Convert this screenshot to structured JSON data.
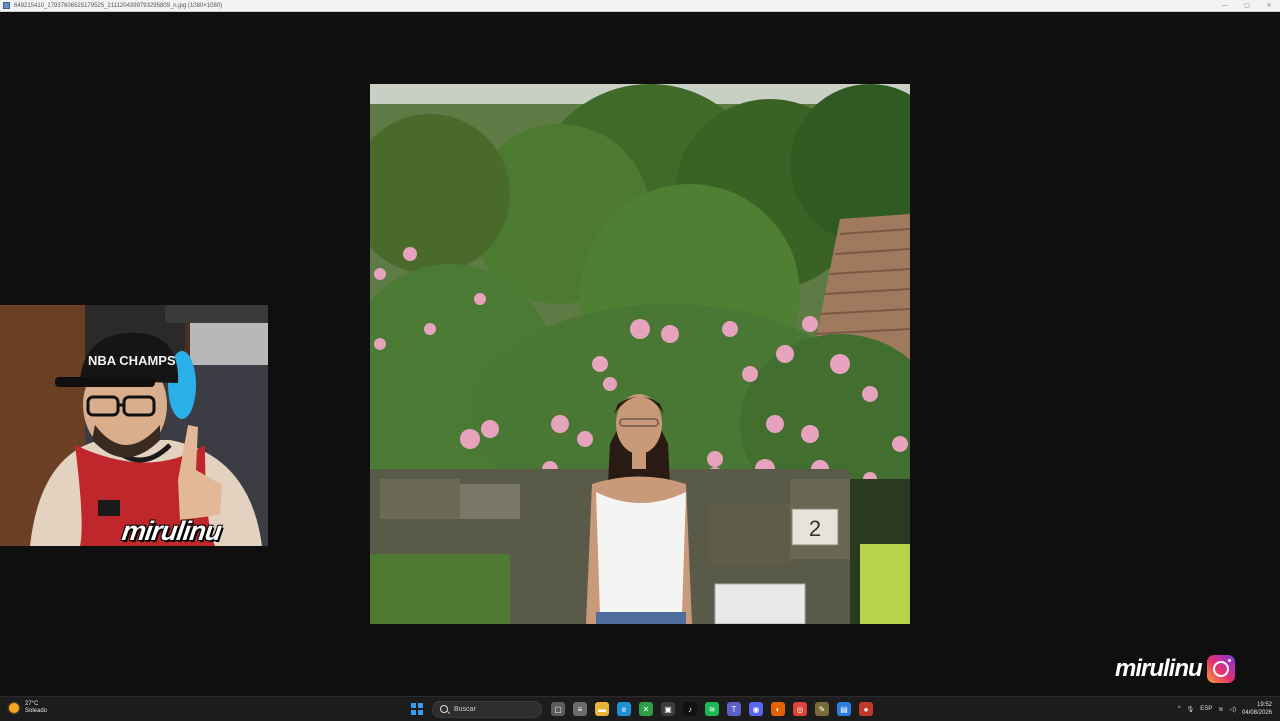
{
  "window": {
    "title": "649215410_17937606525179525_2111204399793295809_n.jpg (1080×1080)",
    "controls": {
      "minimize": "—",
      "maximize": "▢",
      "close": "✕"
    }
  },
  "overlay": {
    "webcam_logo": "mirulinu",
    "brand_text": "mirulinu",
    "brand_icon": "instagram-icon"
  },
  "photo": {
    "house_number": "2"
  },
  "webcam": {
    "cap_text": "NBA CHAMPS"
  },
  "taskbar": {
    "weather_temp": "27°C",
    "weather_desc": "Soleado",
    "search_placeholder": "Buscar",
    "apps": [
      {
        "name": "task-view-icon",
        "glyph": "▢",
        "color": "#5c5c5c"
      },
      {
        "name": "notepad-icon",
        "glyph": "≡",
        "color": "#6b6b6b"
      },
      {
        "name": "file-explorer-icon",
        "glyph": "▬",
        "color": "#e8b43a"
      },
      {
        "name": "edge-icon",
        "glyph": "e",
        "color": "#1f8fd6"
      },
      {
        "name": "xbox-icon",
        "glyph": "✕",
        "color": "#2f9e44"
      },
      {
        "name": "store-icon",
        "glyph": "▣",
        "color": "#3c3c3c"
      },
      {
        "name": "tiktok-icon",
        "glyph": "♪",
        "color": "#111111"
      },
      {
        "name": "spotify-icon",
        "glyph": "≋",
        "color": "#1db954"
      },
      {
        "name": "teams-icon",
        "glyph": "T",
        "color": "#5b5fc7"
      },
      {
        "name": "discord-icon",
        "glyph": "◉",
        "color": "#5865f2"
      },
      {
        "name": "firefox-icon",
        "glyph": "◐",
        "color": "#e66000"
      },
      {
        "name": "chrome-icon",
        "glyph": "◎",
        "color": "#db4437"
      },
      {
        "name": "brush-icon",
        "glyph": "✎",
        "color": "#7a6a3a"
      },
      {
        "name": "docs-icon",
        "glyph": "▤",
        "color": "#2a7de1"
      },
      {
        "name": "recorder-icon",
        "glyph": "●",
        "color": "#c0392b"
      }
    ],
    "tray": {
      "chevron": "^",
      "mic": "🎙",
      "language": "ESP",
      "wifi": "≋",
      "volume": "◁)"
    },
    "time": "19:52",
    "date": "04/08/2026"
  }
}
